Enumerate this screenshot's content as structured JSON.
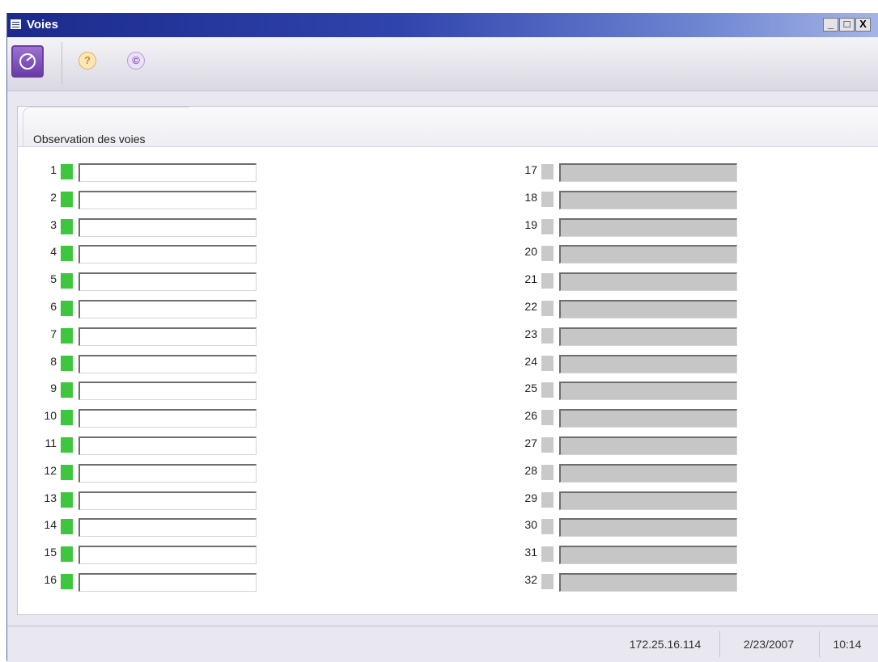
{
  "window": {
    "title": "Voies",
    "minimize_glyph": "_",
    "maximize_glyph": "□",
    "close_glyph": "X"
  },
  "toolbar": {
    "main_button_icon": "gauge-icon",
    "help_glyph": "?",
    "copyright_glyph": "©"
  },
  "panel": {
    "title": "Observation des voies"
  },
  "colors": {
    "active": "#3ec63e",
    "inactive": "#c9c9c9",
    "field_active": "#ffffff",
    "field_inactive": "#c6c6c6"
  },
  "channels_left": [
    {
      "number": "1",
      "state": "active",
      "value": ""
    },
    {
      "number": "2",
      "state": "active",
      "value": ""
    },
    {
      "number": "3",
      "state": "active",
      "value": ""
    },
    {
      "number": "4",
      "state": "active",
      "value": ""
    },
    {
      "number": "5",
      "state": "active",
      "value": ""
    },
    {
      "number": "6",
      "state": "active",
      "value": ""
    },
    {
      "number": "7",
      "state": "active",
      "value": ""
    },
    {
      "number": "8",
      "state": "active",
      "value": ""
    },
    {
      "number": "9",
      "state": "active",
      "value": ""
    },
    {
      "number": "10",
      "state": "active",
      "value": ""
    },
    {
      "number": "11",
      "state": "active",
      "value": ""
    },
    {
      "number": "12",
      "state": "active",
      "value": ""
    },
    {
      "number": "13",
      "state": "active",
      "value": ""
    },
    {
      "number": "14",
      "state": "active",
      "value": ""
    },
    {
      "number": "15",
      "state": "active",
      "value": ""
    },
    {
      "number": "16",
      "state": "active",
      "value": ""
    }
  ],
  "channels_right": [
    {
      "number": "17",
      "state": "inactive",
      "value": ""
    },
    {
      "number": "18",
      "state": "inactive",
      "value": ""
    },
    {
      "number": "19",
      "state": "inactive",
      "value": ""
    },
    {
      "number": "20",
      "state": "inactive",
      "value": ""
    },
    {
      "number": "21",
      "state": "inactive",
      "value": ""
    },
    {
      "number": "22",
      "state": "inactive",
      "value": ""
    },
    {
      "number": "23",
      "state": "inactive",
      "value": ""
    },
    {
      "number": "24",
      "state": "inactive",
      "value": ""
    },
    {
      "number": "25",
      "state": "inactive",
      "value": ""
    },
    {
      "number": "26",
      "state": "inactive",
      "value": ""
    },
    {
      "number": "27",
      "state": "inactive",
      "value": ""
    },
    {
      "number": "28",
      "state": "inactive",
      "value": ""
    },
    {
      "number": "29",
      "state": "inactive",
      "value": ""
    },
    {
      "number": "30",
      "state": "inactive",
      "value": ""
    },
    {
      "number": "31",
      "state": "inactive",
      "value": ""
    },
    {
      "number": "32",
      "state": "inactive",
      "value": ""
    }
  ],
  "statusbar": {
    "ip": "172.25.16.114",
    "date": "2/23/2007",
    "time": "10:14"
  }
}
